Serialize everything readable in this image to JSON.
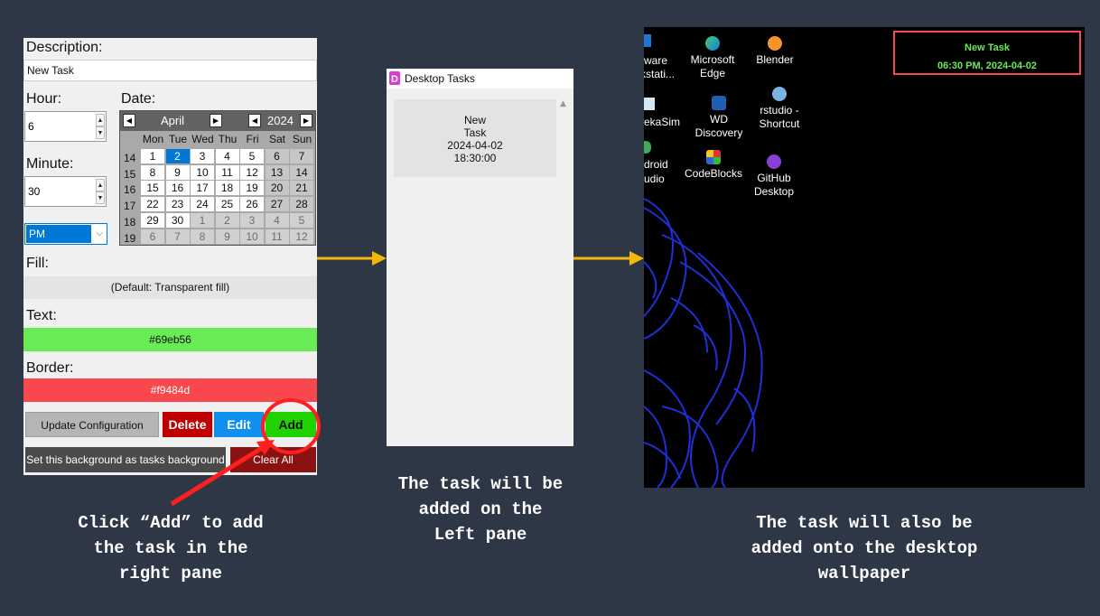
{
  "form": {
    "description_label": "Description:",
    "description_value": "New Task",
    "hour_label": "Hour:",
    "hour_value": "6",
    "minute_label": "Minute:",
    "minute_value": "30",
    "ampm_value": "PM",
    "date_label": "Date:",
    "calendar": {
      "month": "April",
      "year": "2024",
      "days_of_week": [
        "Mon",
        "Tue",
        "Wed",
        "Thu",
        "Fri",
        "Sat",
        "Sun"
      ],
      "weeks": [
        {
          "num": "14",
          "days": [
            "1",
            "2",
            "3",
            "4",
            "5",
            "6",
            "7"
          ]
        },
        {
          "num": "15",
          "days": [
            "8",
            "9",
            "10",
            "11",
            "12",
            "13",
            "14"
          ]
        },
        {
          "num": "16",
          "days": [
            "15",
            "16",
            "17",
            "18",
            "19",
            "20",
            "21"
          ]
        },
        {
          "num": "17",
          "days": [
            "22",
            "23",
            "24",
            "25",
            "26",
            "27",
            "28"
          ]
        },
        {
          "num": "18",
          "days": [
            "29",
            "30",
            "1",
            "2",
            "3",
            "4",
            "5"
          ]
        },
        {
          "num": "19",
          "days": [
            "6",
            "7",
            "8",
            "9",
            "10",
            "11",
            "12"
          ]
        }
      ],
      "selected_day": "2"
    },
    "fill_label": "Fill:",
    "fill_value": "(Default: Transparent fill)",
    "text_label": "Text:",
    "text_color": "#69eb56",
    "border_label": "Border:",
    "border_color": "#f9484d",
    "buttons": {
      "update": "Update Configuration",
      "delete": "Delete",
      "edit": "Edit",
      "add": "Add",
      "set_bg": "Set this background as tasks background",
      "clear_all": "Clear All"
    }
  },
  "window": {
    "title": "Desktop Tasks",
    "task": {
      "name_line1": "New",
      "name_line2": "Task",
      "date": "2024-04-02",
      "time": "18:30:00"
    }
  },
  "desktop": {
    "icons": [
      {
        "label1": "Microsoft",
        "label2": "Edge"
      },
      {
        "label1": "Blender",
        "label2": ""
      },
      {
        "label1": "WD",
        "label2": "Discovery"
      },
      {
        "label1": "rstudio -",
        "label2": "Shortcut"
      },
      {
        "label1": "CodeBlocks",
        "label2": ""
      },
      {
        "label1": "GitHub",
        "label2": "Desktop"
      }
    ],
    "clipped": [
      "ware",
      "kstati...",
      "ekaSim",
      "droid",
      "udio"
    ],
    "widget": {
      "title": "New Task",
      "datetime": "06:30 PM, 2024-04-02"
    }
  },
  "captions": {
    "left": [
      "Click “Add” to add",
      "the task in the",
      "right pane"
    ],
    "middle": [
      "The task will be",
      "added on the",
      "Left pane"
    ],
    "right": [
      "The task will also be",
      "added onto the desktop",
      "wallpaper"
    ]
  },
  "colors": {
    "background": "#2e3746",
    "arrow": "#f5b70a",
    "annotation": "#ff1f1f",
    "add_button": "#1fd200",
    "delete_button": "#c00000",
    "edit_button": "#0f90ee",
    "clear_button": "#8a1212"
  }
}
